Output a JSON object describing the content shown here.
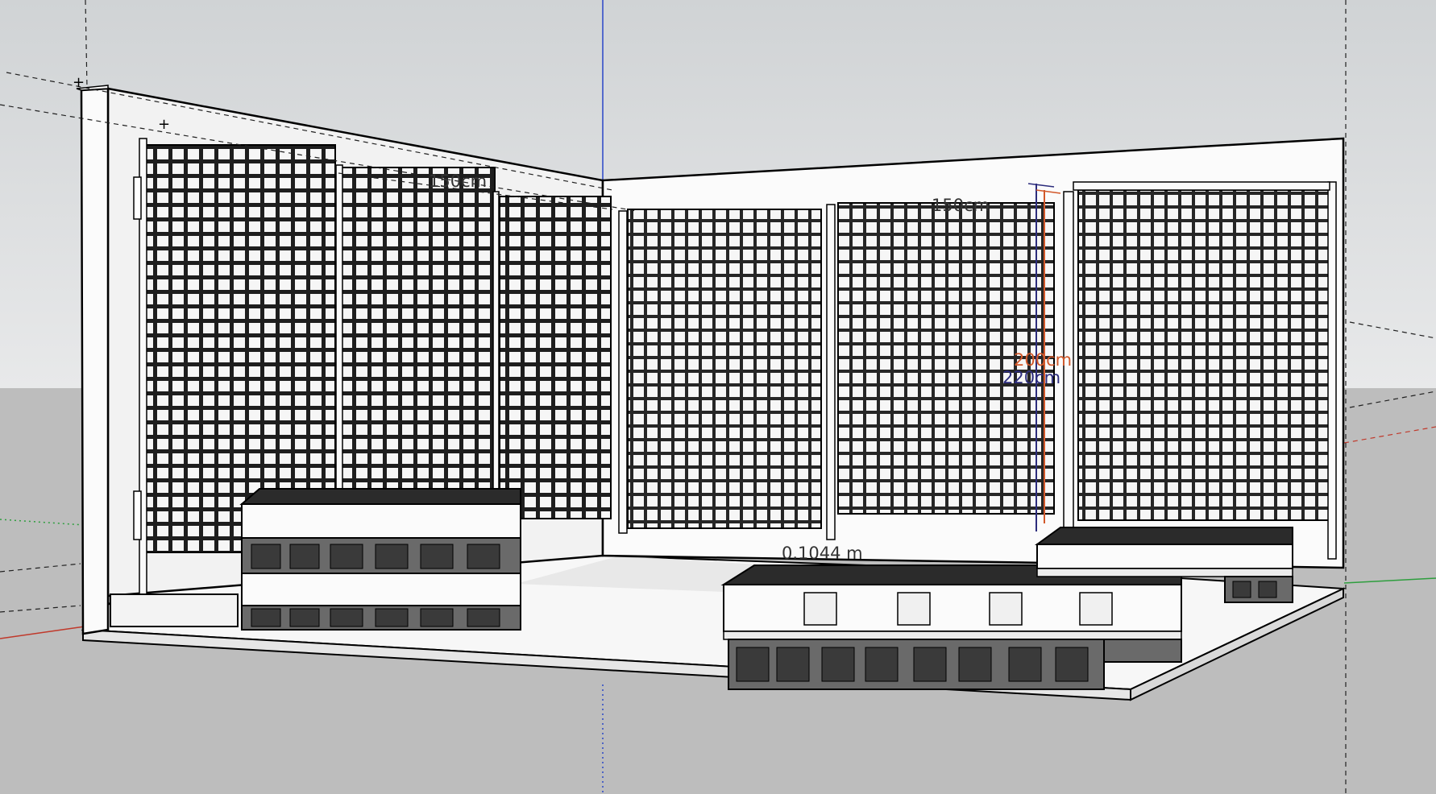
{
  "app": {
    "colors": {
      "sky_top": "#d0d3d5",
      "sky_bottom": "#e7e8e9",
      "ground": "#bcbcbc",
      "floor": "#f7f7f7",
      "wall": "#fbfbfb",
      "grid_line": "#1e1e1e",
      "cushion": "#2b2b2b",
      "block": "#6a6a6a",
      "axis_red": "#c0392b",
      "axis_green": "#2e9e3e",
      "axis_blue": "#2a46c8",
      "dim_red": "#d2582a",
      "dim_blue": "#2c2c7c",
      "guide": "#2a2a2a"
    }
  },
  "dimensions": {
    "back_wall_width": "150cm",
    "right_wall_width": "150cm",
    "panel_height_red": "200cm",
    "panel_height_blue": "220cm",
    "floor_gap": "0.1044 m"
  }
}
